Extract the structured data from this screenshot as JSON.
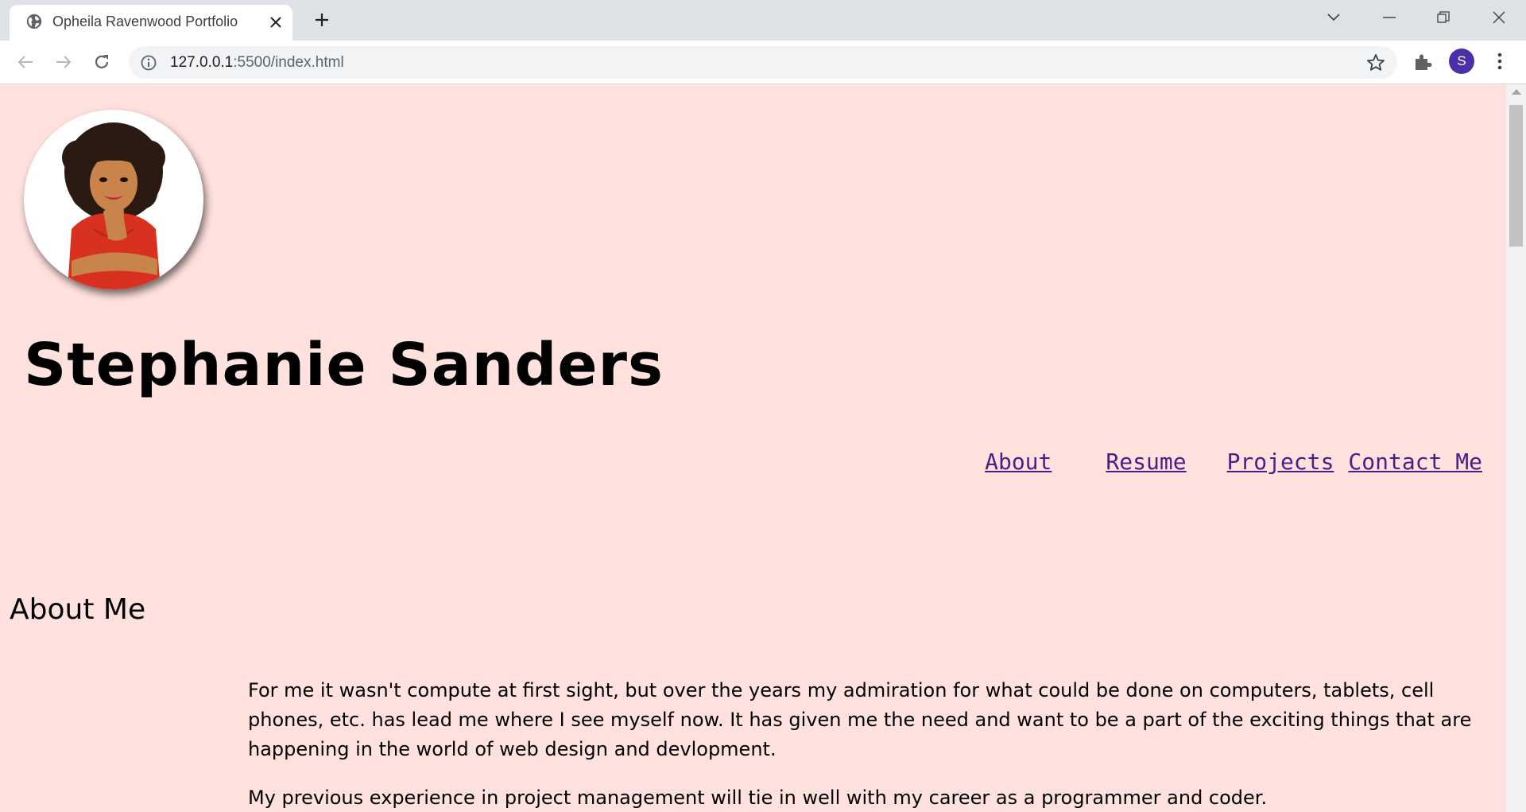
{
  "browser": {
    "tab_title": "Opheila Ravenwood Portfolio",
    "url_host": "127.0.0.1",
    "url_rest": ":5500/index.html",
    "profile_initial": "S"
  },
  "site": {
    "name": "Stephanie Sanders",
    "nav": [
      "About",
      "Resume",
      "Projects",
      "Contact Me"
    ]
  },
  "about": {
    "title": "About Me",
    "paragraphs": [
      "For me it wasn't compute at first sight, but over the years my admiration for what could be done on computers, tablets, cell phones, etc. has lead me where I see myself now. It has given me the need and want to be a part of the exciting things that are happening in the world of web design and devlopment.",
      "My previous experience in project management will tie in well with my career as a programmer and coder."
    ]
  },
  "colors": {
    "page_background": "#ffe1de",
    "link": "#4b1d86",
    "avatar": "#4a2fa8"
  }
}
